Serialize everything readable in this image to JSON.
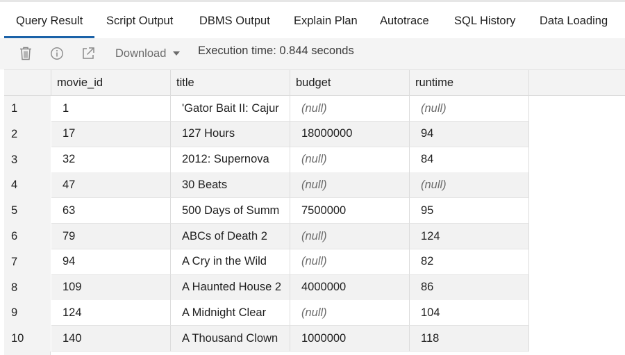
{
  "tabs": [
    {
      "label": "Query Result",
      "active": true
    },
    {
      "label": "Script Output"
    },
    {
      "label": "DBMS Output"
    },
    {
      "label": "Explain Plan"
    },
    {
      "label": "Autotrace"
    },
    {
      "label": "SQL History"
    },
    {
      "label": "Data Loading"
    }
  ],
  "toolbar": {
    "icons": [
      "trash-icon",
      "info-icon",
      "open-external-icon"
    ],
    "download_label": "Download",
    "execution_time": "Execution time: 0.844 seconds"
  },
  "grid": {
    "columns": [
      "movie_id",
      "title",
      "budget",
      "runtime"
    ],
    "rows": [
      {
        "num": "1",
        "movie_id": "1",
        "title": "'Gator Bait II: Cajur",
        "budget": "(null)",
        "runtime": "(null)"
      },
      {
        "num": "2",
        "movie_id": "17",
        "title": "127 Hours",
        "budget": "18000000",
        "runtime": "94"
      },
      {
        "num": "3",
        "movie_id": "32",
        "title": "2012: Supernova",
        "budget": "(null)",
        "runtime": "84"
      },
      {
        "num": "4",
        "movie_id": "47",
        "title": "30 Beats",
        "budget": "(null)",
        "runtime": "(null)"
      },
      {
        "num": "5",
        "movie_id": "63",
        "title": "500 Days of Summ",
        "budget": "7500000",
        "runtime": "95"
      },
      {
        "num": "6",
        "movie_id": "79",
        "title": "ABCs of Death 2",
        "budget": "(null)",
        "runtime": "124"
      },
      {
        "num": "7",
        "movie_id": "94",
        "title": "A Cry in the Wild",
        "budget": "(null)",
        "runtime": "82"
      },
      {
        "num": "8",
        "movie_id": "109",
        "title": "A Haunted House 2",
        "budget": "4000000",
        "runtime": "86"
      },
      {
        "num": "9",
        "movie_id": "124",
        "title": "A Midnight Clear",
        "budget": "(null)",
        "runtime": "104"
      },
      {
        "num": "10",
        "movie_id": "140",
        "title": "A Thousand Clown",
        "budget": "1000000",
        "runtime": "118"
      }
    ]
  },
  "colors": {
    "accent": "#1b62a8",
    "header_bg": "#f3f3f3",
    "stripe_bg": "#f2f2f2",
    "null_text": "#6b6b6b"
  }
}
